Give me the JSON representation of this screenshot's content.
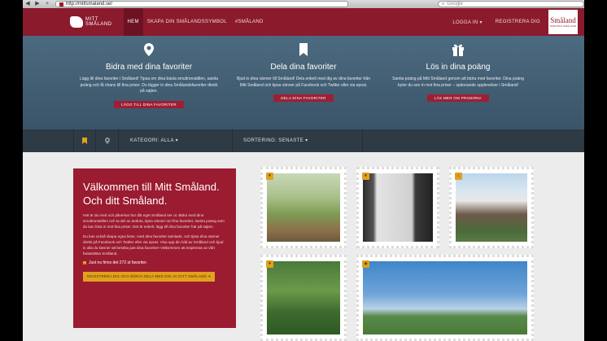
{
  "browser": {
    "url": "http://mittsmaland.se/",
    "search_placeholder": "Google",
    "back_icon": "◀",
    "forward_icon": "▶",
    "add_icon": "+"
  },
  "header": {
    "logo_line1": "MITT",
    "logo_line2": "SMÅLAND",
    "nav": [
      "HEM",
      "SKAPA DIN SMÅLANDSSYMBOL",
      "#SMÅLAND"
    ],
    "login": "LOGGA IN ▾",
    "register": "REGISTRERA DIG",
    "brand_name": "Småland",
    "brand_tag": "SVENSKA SMÅLAND"
  },
  "features": [
    {
      "icon": "map-pin-icon",
      "title": "Bidra med dina favoriter",
      "text": "Lägg till dina favoriter i Småland! Tipsa om dina bästa smultronställen, samla poäng och få chans till fina priser. Du lägger in dina Smålandsfavoriter direkt på sajten.",
      "button": "LÄGG TILL DINA FAVORITER"
    },
    {
      "icon": "bookmark-icon",
      "title": "Dela dina favoriter",
      "text": "Bjud in dina vänner till Småland! Dela enkelt med dig av dina favoriter från Mitt Småland och tipsa vänner på Facebook och Twitter eller via epost.",
      "button": "DELA DINA FAVORITER"
    },
    {
      "icon": "gift-icon",
      "title": "Lös in dina poäng",
      "text": "Samla poäng på Mitt Småland genom att bidra med favoriter. Dina poäng byter du sen in mot fina priser – spännande upplevelser i Småland!",
      "button": "LÄS MER OM PRISERNA"
    }
  ],
  "filters": {
    "category": "KATEGORI: ALLA ▾",
    "sort": "SORTERING: SENASTE ▾"
  },
  "welcome": {
    "title_line1": "Välkommen till Mitt Småland.",
    "title_line2": "Och ditt Småland.",
    "para1": "Här är du med och påverkar hur ditt eget Småland ser ut. Bidra med dina smultronställen och ta del av andras, tipsa vänner om fina favoriter, samla poäng som du kan lösa in mot fina priser. Det är enkelt, lägg till dina favoriter här på sajten.",
    "para2": "Du kan också skapa egna listor, med dina favoriter samlade, och tipsa dina vänner direkt på Facebook och Twitter eller via epost. Visa upp din bild av Småland och bjud in alla du känner att besöka just dina favoriter! Välkommen att inspireras av vårt fantastiska Småland.",
    "count": "Just nu finns det 272 st favoriter.",
    "cta": "REGISTRERA DIG OCH BÖRJA DELA MED DIG AV DITT SMÅLAND ➔"
  },
  "colors": {
    "brand": "#8a1a2c",
    "hero": "#3e596d",
    "filterbar": "#2e3a44",
    "accent": "#e0a21e"
  }
}
